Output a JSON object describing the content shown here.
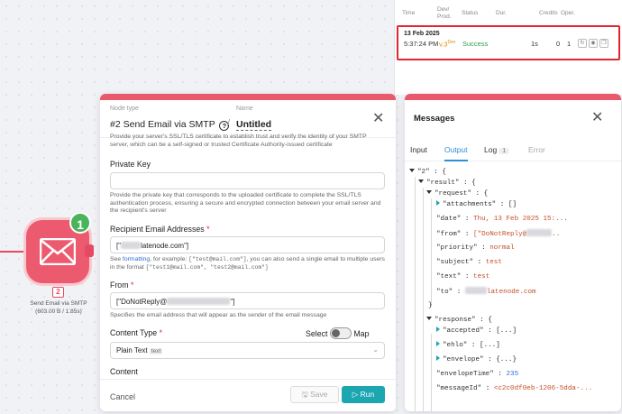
{
  "history": {
    "columns": [
      "Time",
      "Dev/ Prod.",
      "Status",
      "Dur.",
      "Credits",
      "Oper."
    ],
    "row": {
      "date": "13 Feb 2025",
      "time": "5:37:24 PM",
      "version": "v.3",
      "version_sup": "Dev",
      "status": "Success",
      "duration": "1s",
      "credits": "0",
      "operations": "1"
    }
  },
  "node": {
    "badge": "1",
    "number": "2",
    "label_line1": "Send Email via SMTP",
    "label_line2": "(603.00 B / 1.85s)"
  },
  "panel": {
    "node_type_label": "Node type",
    "node_type": "#2 Send Email via SMTP",
    "name_label": "Name",
    "name": "Untitled",
    "ssl_help": "Provide your server's SSL/TLS certificate to establish trust and verify the identity of your SMTP server, which can be a self-signed or trusted Certificate Authority-issued certificate",
    "private_key_label": "Private Key",
    "private_key_value": "",
    "private_key_help": "Provide the private key that corresponds to the uploaded certificate to complete the SSL/TLS authentication process, ensuring a secure and encrypted connection between your email server and the recipient's server",
    "recipient_label": "Recipient Email Addresses",
    "recipient_value_prefix": "[\"",
    "recipient_value_suffix": "latenode.com\"]",
    "recipient_help_1": "See ",
    "recipient_help_link": "formatting",
    "recipient_help_2": ", for example: ",
    "recipient_help_code1": "[\"test@mail.com\"]",
    "recipient_help_3": ", you can also send a single email to multiple users in the format ",
    "recipient_help_code2": "[\"test1@mail.com\", \"test2@mail.com\"]",
    "from_label": "From",
    "from_value_prefix": "[\"DoNotReply@",
    "from_value_suffix": "\"]",
    "from_help": "Specifies the email address that will appear as the sender of the email message",
    "content_type_label": "Content Type",
    "select_label": "Select",
    "map_label": "Map",
    "content_type_value": "Plain Text",
    "content_type_tag": "text",
    "content_label": "Content",
    "cancel": "Cancel",
    "save": "Save",
    "run": "Run"
  },
  "messages": {
    "title": "Messages",
    "tabs": {
      "input": "Input",
      "output": "Output",
      "log": "Log",
      "log_count": "1",
      "error": "Error"
    },
    "tree": {
      "root_key": "\"2\"",
      "result_key": "\"result\"",
      "request_key": "\"request\"",
      "attachments_key": "\"attachments\"",
      "attachments_val": "[]",
      "date_key": "\"date\"",
      "date_val": "Thu, 13 Feb 2025 15:...",
      "from_key": "\"from\"",
      "from_val_prefix": "[\"DoNotReply@",
      "from_val_suffix": "..",
      "priority_key": "\"priority\"",
      "priority_val": "normal",
      "subject_key": "\"subject\"",
      "subject_val": "test",
      "text_key": "\"text\"",
      "text_val": "test",
      "to_key": "\"to\"",
      "to_val_suffix": "latenode.com",
      "close_brace": "}",
      "response_key": "\"response\"",
      "accepted_key": "\"accepted\"",
      "accepted_val": "[...]",
      "ehlo_key": "\"ehlo\"",
      "ehlo_val": "[...]",
      "envelope_key": "\"envelope\"",
      "envelope_val": "{...}",
      "envelopeTime_key": "\"envelopeTime\"",
      "envelopeTime_val": "235",
      "messageId_key": "\"messageId\"",
      "messageId_val": "<c2c0df0eb-1206-5dda-..."
    }
  }
}
